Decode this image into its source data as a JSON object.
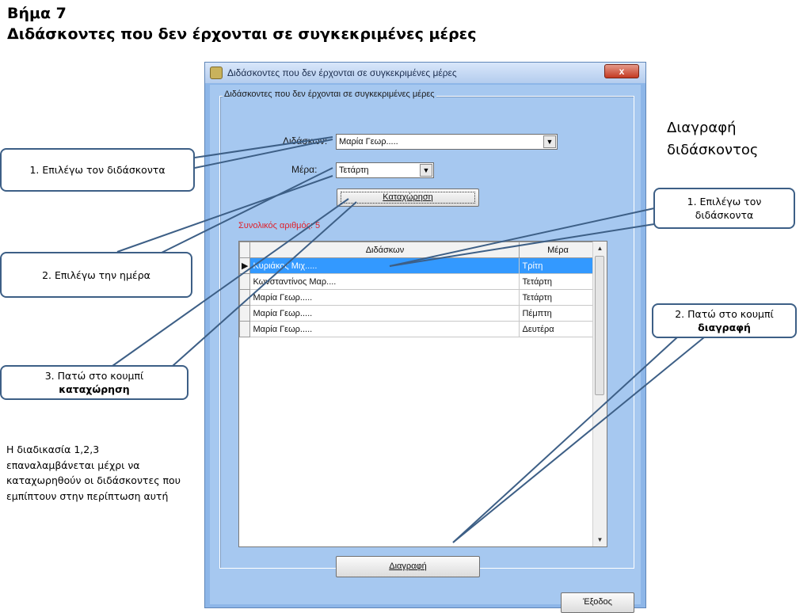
{
  "slide": {
    "title_line1": "Βήμα 7",
    "title_line2": "Διδάσκοντες που δεν έρχονται σε συγκεκριμένες μέρες"
  },
  "window": {
    "title": "Διδάσκοντες που δεν έρχονται σε συγκεκριμένες μέρες",
    "close_label": "x",
    "group_legend": "Διδάσκοντες που δεν έρχονται σε συγκεκριμένες μέρες",
    "teacher_label": "Διδάσκων:",
    "teacher_value": "Μαρία Γεωρ.....",
    "day_label": "Μέρα:",
    "day_value": "Τετάρτη",
    "register_button": "Καταχώρηση",
    "total_label": "Συνολικός αριθμός: 5",
    "grid": {
      "headers": [
        "Διδάσκων",
        "Μέρα"
      ],
      "rows": [
        {
          "teacher": "Κυριάκος Μιχ.....",
          "day": "Τρίτη",
          "selected": true
        },
        {
          "teacher": "Κωνσταντίνος Μαρ....",
          "day": "Τετάρτη",
          "selected": false
        },
        {
          "teacher": "Μαρία Γεωρ.....",
          "day": "Τετάρτη",
          "selected": false
        },
        {
          "teacher": "Μαρία Γεωρ.....",
          "day": "Πέμπτη",
          "selected": false
        },
        {
          "teacher": "Μαρία Γεωρ.....",
          "day": "Δευτέρα",
          "selected": false
        }
      ]
    },
    "delete_button": "Διαγραφή",
    "exit_button": "Έξοδος"
  },
  "callouts": {
    "left_1": "1. Επιλέγω τον διδάσκοντα",
    "left_2": "2. Επιλέγω την ημέρα",
    "left_3_line1": "3. Πατώ στο κουμπί",
    "left_3_line2": "καταχώρηση",
    "right_1_line1": "1. Επιλέγω τον",
    "right_1_line2": "διδάσκοντα",
    "right_2_line1": "2. Πατώ στο κουμπί",
    "right_2_line2": "διαγραφή"
  },
  "right_heading_line1": "Διαγραφή",
  "right_heading_line2": "διδάσκοντος",
  "note_lines": [
    "Η διαδικασία 1,2,3",
    "επαναλαμβάνεται μέχρι να",
    "καταχωρηθούν οι διδάσκοντες που",
    "εμπίπτουν στην περίπτωση αυτή"
  ],
  "colors": {
    "window_bg": "#a6c8f0",
    "selection": "#3399ff",
    "total_text": "#e0202a",
    "callout_border": "#3d5f86"
  }
}
